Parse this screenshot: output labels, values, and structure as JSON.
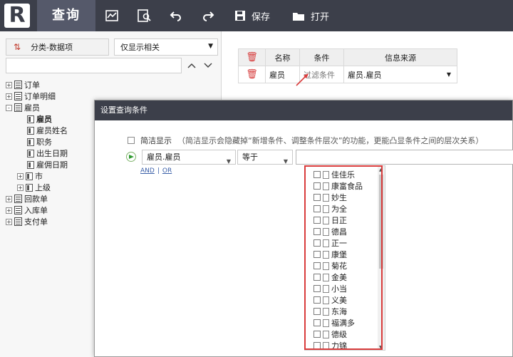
{
  "toolbar": {
    "logo_letter": "R",
    "app_title": "查询",
    "save_label": "保存",
    "open_label": "打开"
  },
  "left_panel": {
    "classify_button": "分类-数据项",
    "filter_select_value": "仅显示相关",
    "tree": [
      {
        "label": "订单",
        "toggle": "+",
        "level": 0,
        "type": "table"
      },
      {
        "label": "订单明细",
        "toggle": "+",
        "level": 0,
        "type": "table"
      },
      {
        "label": "雇员",
        "toggle": "-",
        "level": 0,
        "type": "table"
      },
      {
        "label": "雇员",
        "level": 1,
        "type": "field",
        "bold": true
      },
      {
        "label": "雇员姓名",
        "level": 1,
        "type": "field"
      },
      {
        "label": "职务",
        "level": 1,
        "type": "field"
      },
      {
        "label": "出生日期",
        "level": 1,
        "type": "field"
      },
      {
        "label": "雇佣日期",
        "level": 1,
        "type": "field"
      },
      {
        "label": "市",
        "toggle": "+",
        "level": 1,
        "type": "field"
      },
      {
        "label": "上级",
        "toggle": "+",
        "level": 1,
        "type": "field"
      },
      {
        "label": "回款单",
        "toggle": "+",
        "level": 0,
        "type": "table"
      },
      {
        "label": "入库单",
        "toggle": "+",
        "level": 0,
        "type": "table"
      },
      {
        "label": "支付单",
        "toggle": "+",
        "level": 0,
        "type": "table"
      }
    ]
  },
  "condition_table": {
    "headers": [
      "名称",
      "条件",
      "信息来源"
    ],
    "row": {
      "name": "雇员",
      "condition": "过滤条件",
      "source": "雇员.雇员"
    }
  },
  "dialog": {
    "title": "设置查询条件",
    "simple_label": "简洁显示",
    "simple_note": "（简洁显示会隐藏掉“新增条件、调整条件层次”的功能，更能凸显条件之间的层次关系）",
    "field_value": "雇员.雇员",
    "operator_value": "等于",
    "and_label": "AND",
    "separator": "|",
    "or_label": "OR",
    "options": [
      "佳佳乐",
      "康富食品",
      "妙生",
      "为全",
      "日正",
      "德昌",
      "正一",
      "康堡",
      "菊花",
      "金美",
      "小当",
      "义美",
      "东海",
      "福满多",
      "德级",
      "力锦"
    ]
  },
  "colors": {
    "toolbar_bg": "#3c3f4a",
    "highlight_red": "#d93c3c",
    "link_blue": "#3a5fa8"
  }
}
